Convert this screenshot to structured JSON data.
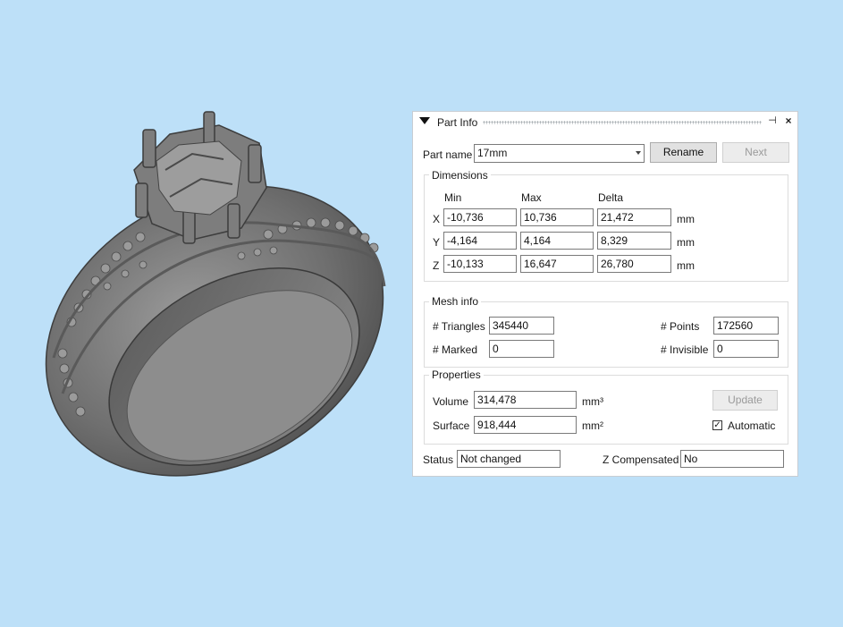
{
  "panel": {
    "title": "Part Info",
    "part_name_label": "Part name",
    "part_name_value": "17mm",
    "rename_label": "Rename",
    "next_label": "Next",
    "dimensions": {
      "title": "Dimensions",
      "col_min": "Min",
      "col_max": "Max",
      "col_delta": "Delta",
      "unit": "mm",
      "rows": [
        {
          "axis": "X",
          "min": "-10,736",
          "max": "10,736",
          "delta": "21,472"
        },
        {
          "axis": "Y",
          "min": "-4,164",
          "max": "4,164",
          "delta": "8,329"
        },
        {
          "axis": "Z",
          "min": "-10,133",
          "max": "16,647",
          "delta": "26,780"
        }
      ]
    },
    "mesh": {
      "title": "Mesh info",
      "triangles_label": "# Triangles",
      "triangles_value": "345440",
      "points_label": "# Points",
      "points_value": "172560",
      "marked_label": "# Marked",
      "marked_value": "0",
      "invisible_label": "# Invisible",
      "invisible_value": "0"
    },
    "properties": {
      "title": "Properties",
      "volume_label": "Volume",
      "volume_value": "314,478",
      "volume_unit": "mm³",
      "surface_label": "Surface",
      "surface_value": "918,444",
      "surface_unit": "mm²",
      "update_label": "Update",
      "automatic_label": "Automatic",
      "automatic_checked": true
    },
    "status_label": "Status",
    "status_value": "Not changed",
    "zcomp_label": "Z Compensated",
    "zcomp_value": "No"
  },
  "colors": {
    "background": "#bde0f8",
    "ring": "#7a7a7a"
  }
}
